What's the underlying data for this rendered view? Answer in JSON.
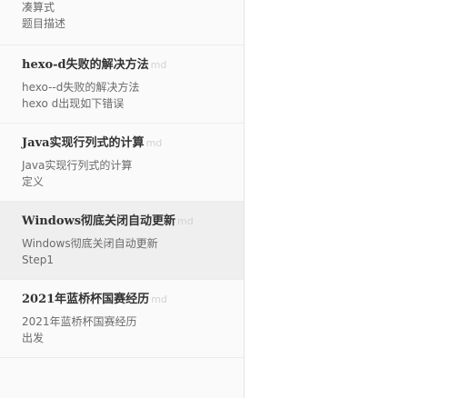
{
  "files": [
    {
      "title": "",
      "ext": "",
      "preview": [
        "凑算式",
        "题目描述"
      ],
      "active": false
    },
    {
      "title": "hexo-d失败的解决方法",
      "ext": "md",
      "preview": [
        "hexo--d失败的解决方法",
        "hexo d出现如下错误"
      ],
      "active": false
    },
    {
      "title": "Java实现行列式的计算",
      "ext": "md",
      "preview": [
        "Java实现行列式的计算",
        "定义"
      ],
      "active": false
    },
    {
      "title": "Windows彻底关闭自动更新",
      "ext": "md",
      "preview": [
        "Windows彻底关闭自动更新",
        "Step1"
      ],
      "active": true
    },
    {
      "title": "2021年蓝桥杯国赛经历",
      "ext": "md",
      "preview": [
        "2021年蓝桥杯国赛经历",
        "出发"
      ],
      "active": false
    }
  ]
}
